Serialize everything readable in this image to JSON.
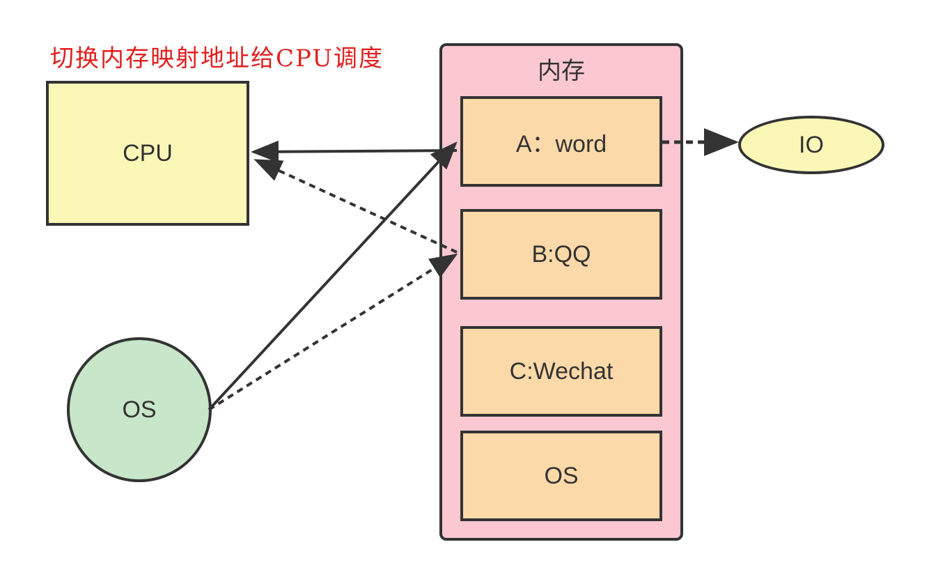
{
  "title": "切换内存映射地址给CPU调度",
  "nodes": {
    "cpu": "CPU",
    "memory": "内存",
    "io": "IO",
    "os": "OS",
    "processes": [
      "A：word",
      "B:QQ",
      "C:Wechat",
      "OS"
    ]
  },
  "colors": {
    "title": "#e02020",
    "cpu_fill": "#fbf7b7",
    "memory_fill": "#fbc8d1",
    "process_fill": "#fcd9a8",
    "os_fill": "#c8e6c9",
    "io_fill": "#fbf7b7",
    "stroke": "#333333"
  },
  "edges": [
    {
      "from": "A：word",
      "to": "CPU",
      "style": "solid"
    },
    {
      "from": "B:QQ",
      "to": "CPU",
      "style": "dashed"
    },
    {
      "from": "OS",
      "to": "A：word",
      "style": "solid"
    },
    {
      "from": "OS",
      "to": "B:QQ",
      "style": "dashed"
    },
    {
      "from": "A：word",
      "to": "IO",
      "style": "dashed"
    }
  ]
}
